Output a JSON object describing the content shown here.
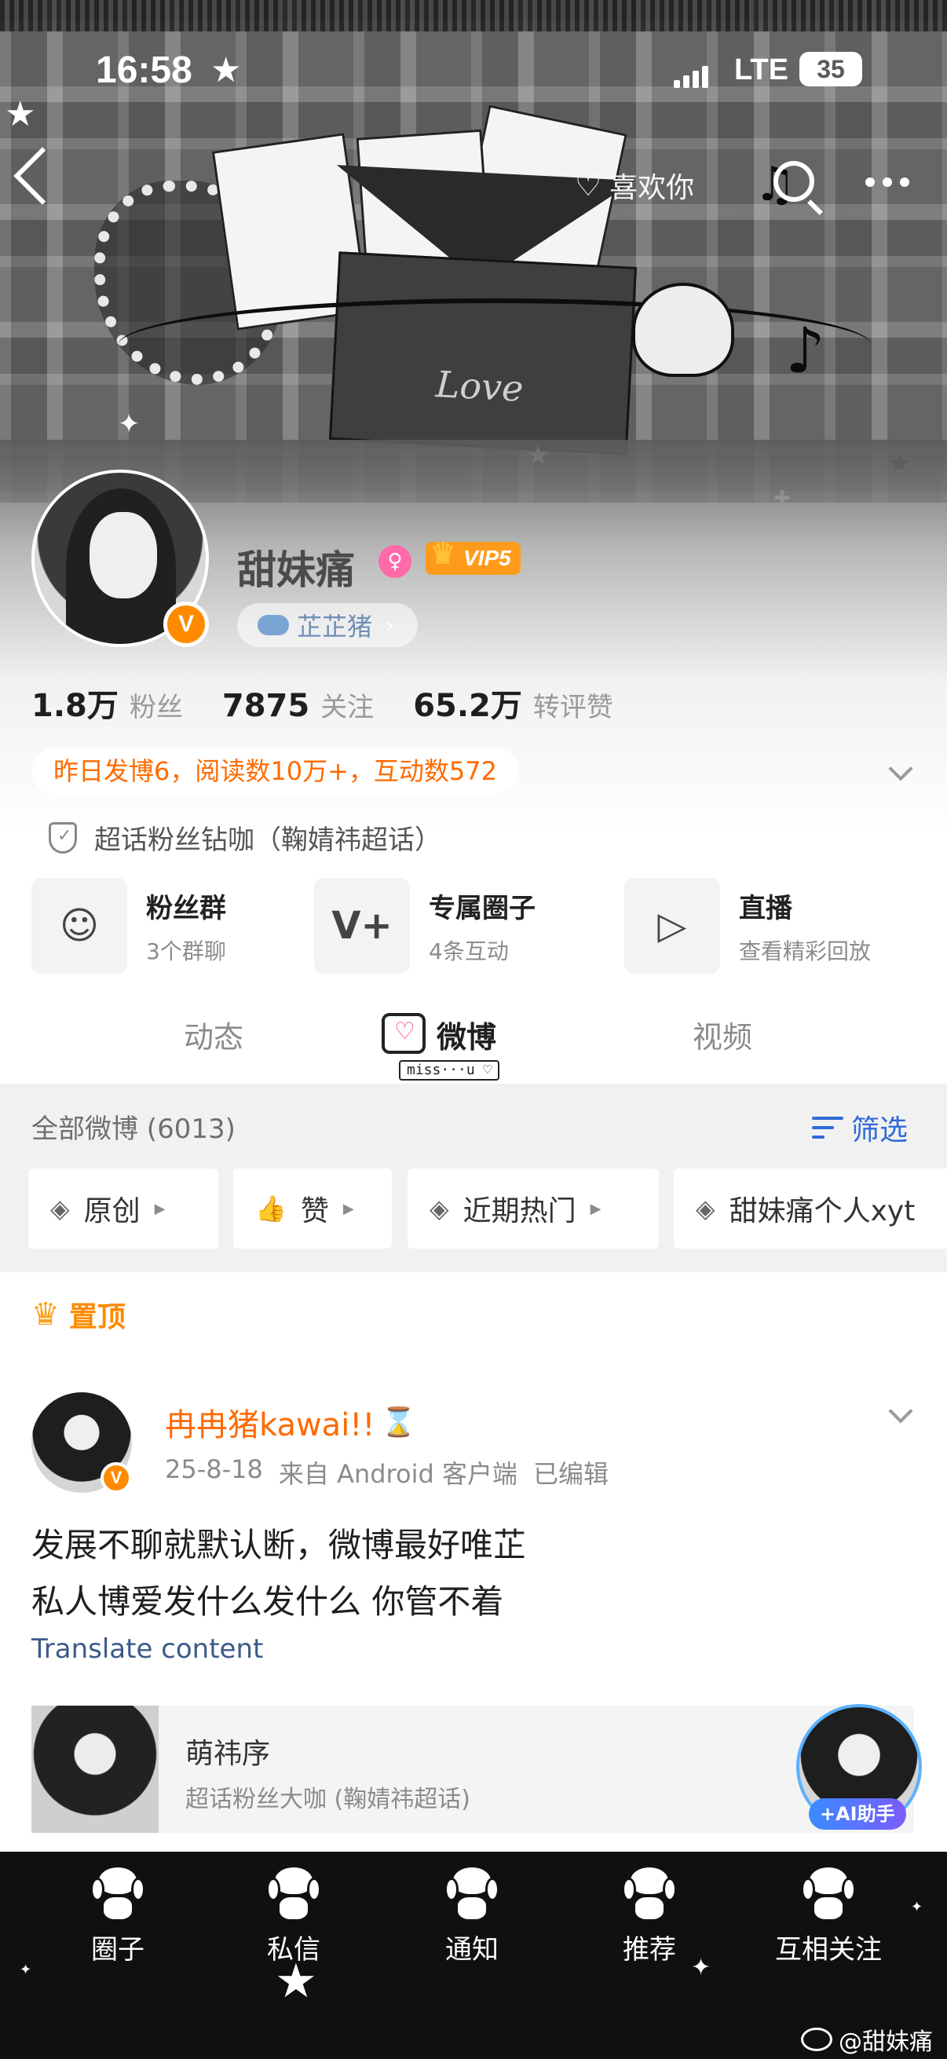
{
  "status_bar": {
    "time": "16:58",
    "network": "LTE",
    "battery": "35"
  },
  "header": {
    "like_label": "喜欢你",
    "banner_text": "Love"
  },
  "profile": {
    "name": "甜妹痛",
    "vip": "VIP5",
    "fan_tag": "芷芷猪",
    "stats": [
      {
        "value": "1.8万",
        "label": "粉丝"
      },
      {
        "value": "7875",
        "label": "关注"
      },
      {
        "value": "65.2万",
        "label": "转评赞"
      }
    ],
    "summary": "昨日发博6，阅读数10万+，互动数572",
    "super_topic": "超话粉丝钻咖（鞠婧祎超话）"
  },
  "features": [
    {
      "title": "粉丝群",
      "sub": "3个群聊"
    },
    {
      "title": "专属圈子",
      "sub": "4条互动"
    },
    {
      "title": "直播",
      "sub": "查看精彩回放"
    }
  ],
  "tabs": [
    "动态",
    "微博",
    "视频"
  ],
  "tab_tag": "miss···u ♡",
  "feed": {
    "all_posts": "全部微博 (6013)",
    "filter": "筛选",
    "chips": [
      "原创",
      "赞",
      "近期热门",
      "甜妹痛个人xyt"
    ],
    "pinned": "置顶"
  },
  "post": {
    "author": "冉冉猪kawai!!",
    "date": "25-8-18",
    "source": "来自 Android 客户端",
    "edited": "已编辑",
    "body_line1": "发展不聊就默认断，微博最好唯芷",
    "body_line2": "私人博爱发什么发什么 你管不着",
    "translate": "Translate content",
    "embed_title": "萌祎序",
    "embed_sub": "超话粉丝大咖 (鞠婧祎超话)",
    "ai_label": "+AI助手"
  },
  "bottom_nav": [
    "圈子",
    "私信",
    "通知",
    "推荐",
    "互相关注"
  ],
  "watermark": "@甜妹痛",
  "colors": {
    "accent_orange": "#ff6a00",
    "link_blue": "#2f6bd8",
    "vip": "#ff9b1a"
  }
}
